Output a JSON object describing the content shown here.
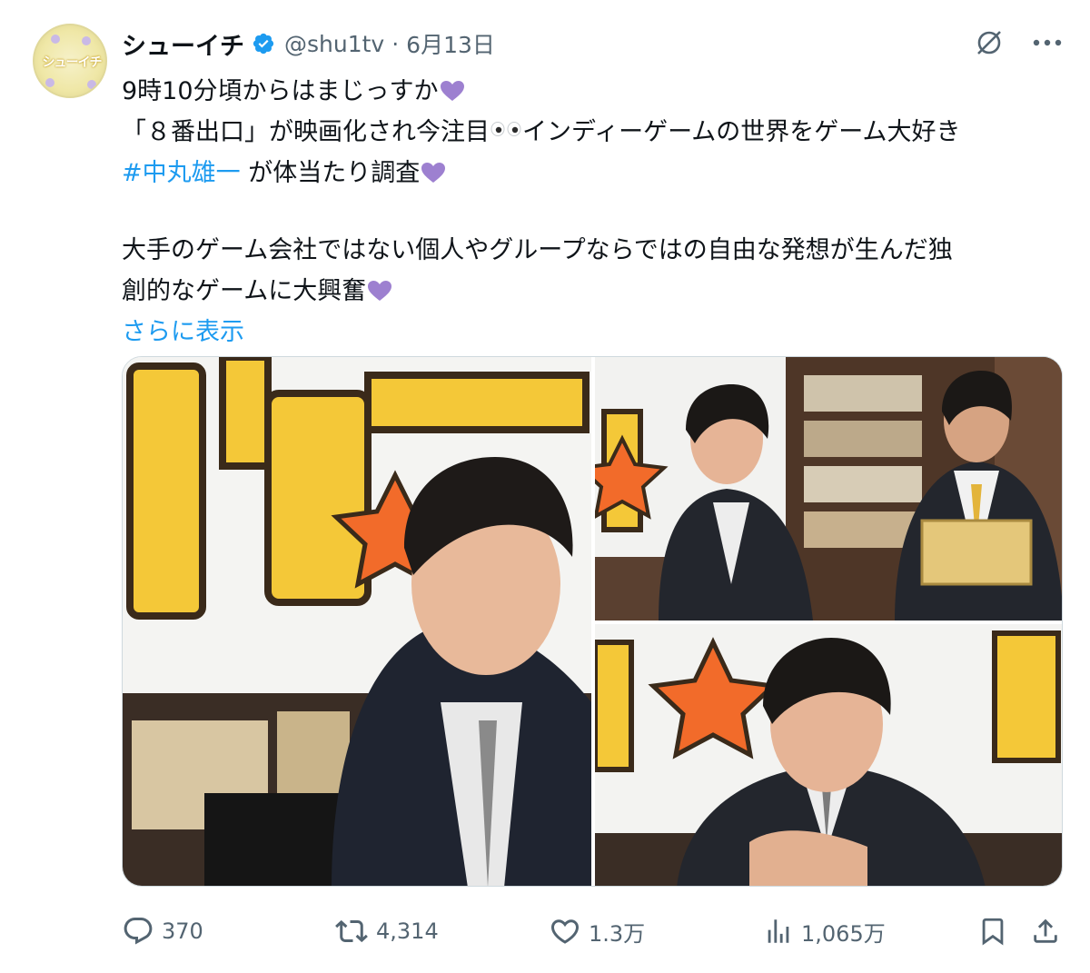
{
  "tweet": {
    "display_name": "シューイチ",
    "handle": "@shu1tv",
    "separator": "·",
    "date": "6月13日",
    "avatar_text": "シューイチ",
    "lines": {
      "l1": "9時10分頃からはまじっすか",
      "l2a": "「８番出口」が映画化され今注目",
      "l2b": "インディーゲームの世界をゲーム大好き",
      "hashtag": "#中丸雄一",
      "l3": " が体当たり調査",
      "l4": "大手のゲーム会社ではない個人やグループならではの自由な発想が生んだ独",
      "l5": "創的なゲームに大興奮"
    },
    "show_more": "さらに表示"
  },
  "actions": {
    "replies": "370",
    "reposts": "4,314",
    "likes": "1.3万",
    "views": "1,065万"
  },
  "colors": {
    "link": "#1d9bf0",
    "verified": "#1d9bf0",
    "heart_emoji": "#9d80d0",
    "muted": "#536471"
  },
  "icons": [
    "verified-badge-icon",
    "grok-icon",
    "more-icon",
    "reply-icon",
    "repost-icon",
    "like-icon",
    "views-icon",
    "bookmark-icon",
    "share-icon",
    "purple-heart-icon",
    "eyes-icon"
  ]
}
